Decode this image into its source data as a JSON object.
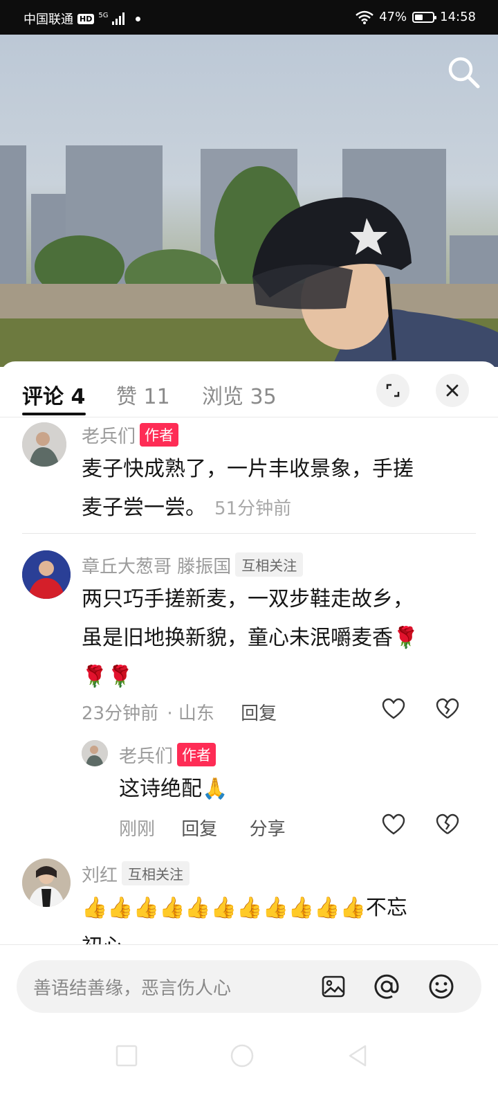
{
  "status_bar": {
    "carrier": "中国联通",
    "hd": "HD",
    "network": "5G",
    "battery": "47%",
    "battery_level": 0.47,
    "time": "14:58"
  },
  "tabs": [
    {
      "label": "评论 4",
      "active": true
    },
    {
      "label": "赞 11",
      "active": false
    },
    {
      "label": "浏览 35",
      "active": false
    }
  ],
  "comments": [
    {
      "user": "老兵们",
      "badge": "作者",
      "text_lines": [
        "麦子快成熟了，一片丰收景象，手搓",
        "麦子尝一尝。"
      ],
      "time": "51分钟前"
    },
    {
      "user": "章丘大葱哥 滕振国",
      "badge": "互相关注",
      "text_lines": [
        "两只巧手搓新麦，一双步鞋走故乡，",
        "虽是旧地换新貌，童心未泯嚼麦香🌹",
        "🌹🌹"
      ],
      "time": "23分钟前",
      "location": "· 山东",
      "reply_label": "回复"
    },
    {
      "user": "老兵们",
      "badge": "作者",
      "text": "这诗绝配🙏",
      "time": "刚刚",
      "reply_label": "回复",
      "share_label": "分享"
    },
    {
      "user": "刘红",
      "badge": "互相关注",
      "text_lines": [
        "👍👍👍👍👍👍👍👍👍👍👍不忘",
        "初心"
      ]
    }
  ],
  "input": {
    "placeholder": "善语结善缘，恶言伤人心"
  },
  "icons": {
    "search": "search-icon",
    "expand": "expand-icon",
    "close": "close-icon",
    "like": "heart-icon",
    "dislike": "broken-heart-icon",
    "image": "image-icon",
    "at": "at-icon",
    "emoji": "emoji-icon"
  },
  "colors": {
    "author_badge": "#fe2c55",
    "status_bar_bg": "#0d0d0d"
  }
}
